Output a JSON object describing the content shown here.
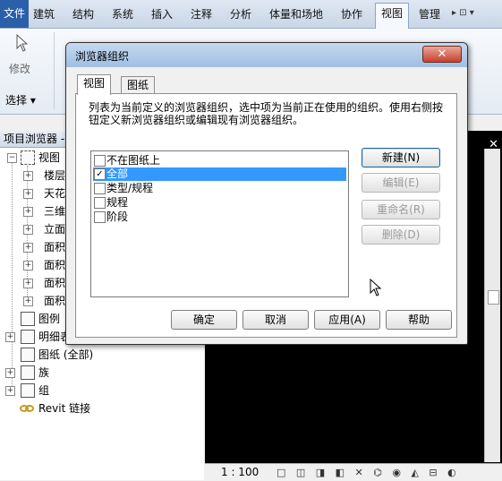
{
  "ribbon": {
    "tabs": [
      "文件",
      "建筑",
      "结构",
      "系统",
      "插入",
      "注释",
      "分析",
      "体量和场地",
      "协作",
      "视图",
      "管理"
    ],
    "active_tab": "视图",
    "overflow": "▸ ⊡ ▾",
    "modify_label": "修改",
    "select_label": "选择 ▾"
  },
  "project_browser": {
    "title": "项目浏览器 -",
    "views_root": "视图",
    "view_items": [
      "楼层",
      "天花",
      "三维",
      "立面",
      "面积",
      "面积",
      "面积",
      "面积"
    ],
    "legends": "图例",
    "schedules": "明细表",
    "sheets": "图纸 (全部)",
    "families": "族",
    "groups": "组",
    "links": "Revit 链接"
  },
  "dialog": {
    "title": "浏览器组织",
    "close_glyph": "✕",
    "tabs": [
      "视图",
      "图纸"
    ],
    "description": "列表为当前定义的浏览器组织，选中项为当前正在使用的组织。使用右侧按钮定义新浏览器组织或编辑现有浏览器组织。",
    "list_items": [
      {
        "label": "不在图纸上",
        "checked": false,
        "selected": false
      },
      {
        "label": "全部",
        "checked": true,
        "selected": true
      },
      {
        "label": "类型/规程",
        "checked": false,
        "selected": false
      },
      {
        "label": "规程",
        "checked": false,
        "selected": false
      },
      {
        "label": "阶段",
        "checked": false,
        "selected": false
      }
    ],
    "side_buttons": {
      "new": "新建(N)",
      "edit": "编辑(E)",
      "rename": "重命名(R)",
      "delete": "删除(D)"
    },
    "footer_buttons": {
      "ok": "确定",
      "cancel": "取消",
      "apply": "应用(A)",
      "help": "帮助"
    }
  },
  "view_area": {
    "close_glyph": "✕",
    "scale": "1 : 100"
  },
  "colors": {
    "selection": "#3399ff",
    "title_close": "#c8402b",
    "file_tab": "#2a5fa9"
  }
}
